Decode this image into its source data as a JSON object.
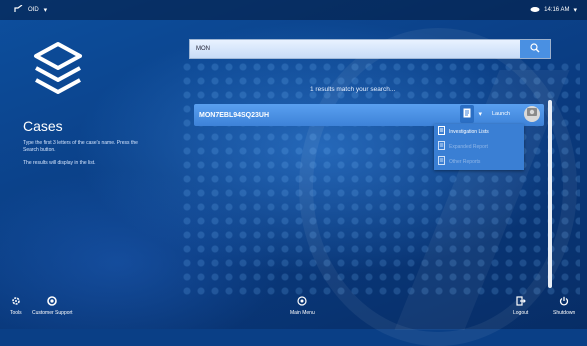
{
  "status": {
    "left_text": "OID",
    "right_text": "14:16 AM"
  },
  "sidebar": {
    "title": "Cases",
    "instructions": "Type the first 3 letters of the case's name. Press the Search button.",
    "note": "The results will display in the list."
  },
  "search": {
    "value": "MON",
    "icon": "search-icon"
  },
  "results": {
    "count_text": "1 results match your search...",
    "rows": [
      {
        "case_id": "MON7EBL94SQ23UH",
        "launch_label": "Launch"
      }
    ]
  },
  "menu": {
    "items": [
      {
        "label": "Investigation Lists",
        "state": "active"
      },
      {
        "label": "Expanded Report",
        "state": "disabled"
      },
      {
        "label": "Other Reports",
        "state": "disabled"
      }
    ]
  },
  "bottom": {
    "tools": "Tools",
    "support": "Customer Support",
    "main_menu": "Main Menu",
    "logout": "Logout",
    "shutdown": "Shutdown"
  },
  "colors": {
    "background": "#0a3f86",
    "accent": "#4a90e2",
    "row": "#3d82d8"
  }
}
